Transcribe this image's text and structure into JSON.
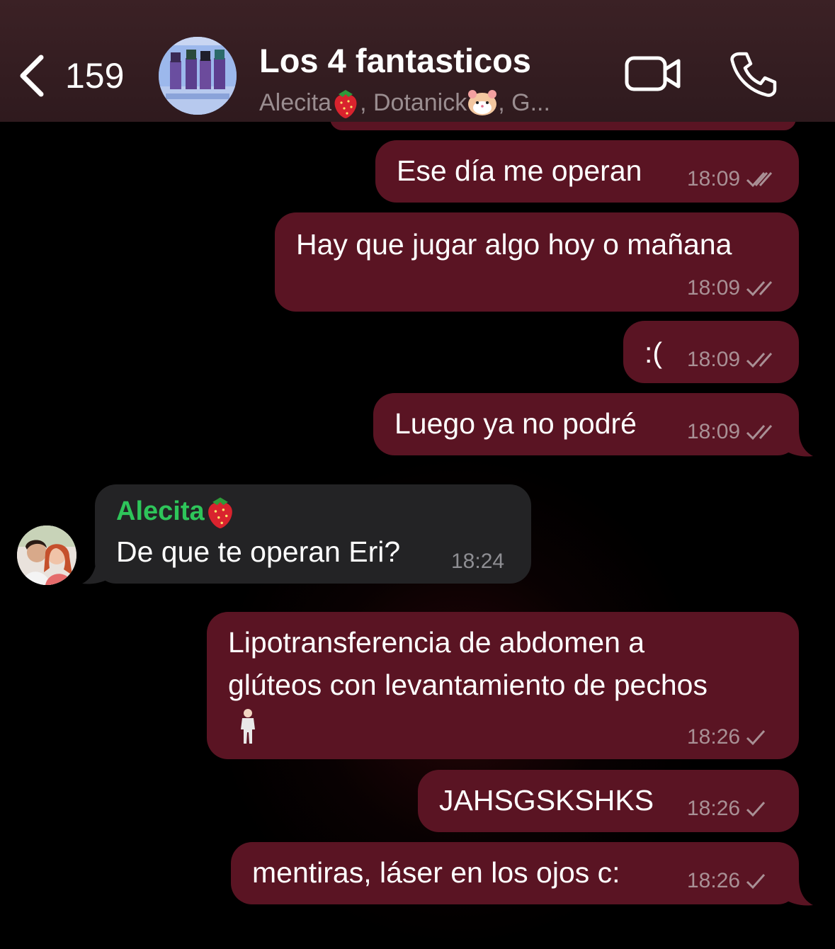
{
  "header": {
    "back_count": "159",
    "title": "Los 4 fantasticos",
    "members_part1": "Alecita ",
    "members_part2": ", Dotanick ",
    "members_part3": ", G..."
  },
  "messages": [
    {
      "text": "Ese día me operan",
      "time": "18:09",
      "status": "read"
    },
    {
      "text": "Hay que jugar algo hoy o mañana",
      "time": "18:09",
      "status": "read"
    },
    {
      "text": ":(",
      "time": "18:09",
      "status": "read"
    },
    {
      "text": "Luego ya no podré",
      "time": "18:09",
      "status": "read"
    },
    {
      "sender": "Alecita ",
      "text": "De que te operan Eri?",
      "time": "18:24"
    },
    {
      "text_line1": "Lipotransferencia de abdomen a",
      "text_line2": "glúteos con levantamiento de pechos",
      "time": "18:26",
      "status": "sent"
    },
    {
      "text": "JAHSGSKSHKS",
      "time": "18:26",
      "status": "sent"
    },
    {
      "text": "mentiras, láser en los ojos c:",
      "time": "18:26",
      "status": "sent"
    }
  ],
  "colors": {
    "outgoing_bubble": "#5a1423",
    "incoming_bubble": "#232325",
    "sender_name": "#2ec55a",
    "header_bg": "#3b2125"
  }
}
